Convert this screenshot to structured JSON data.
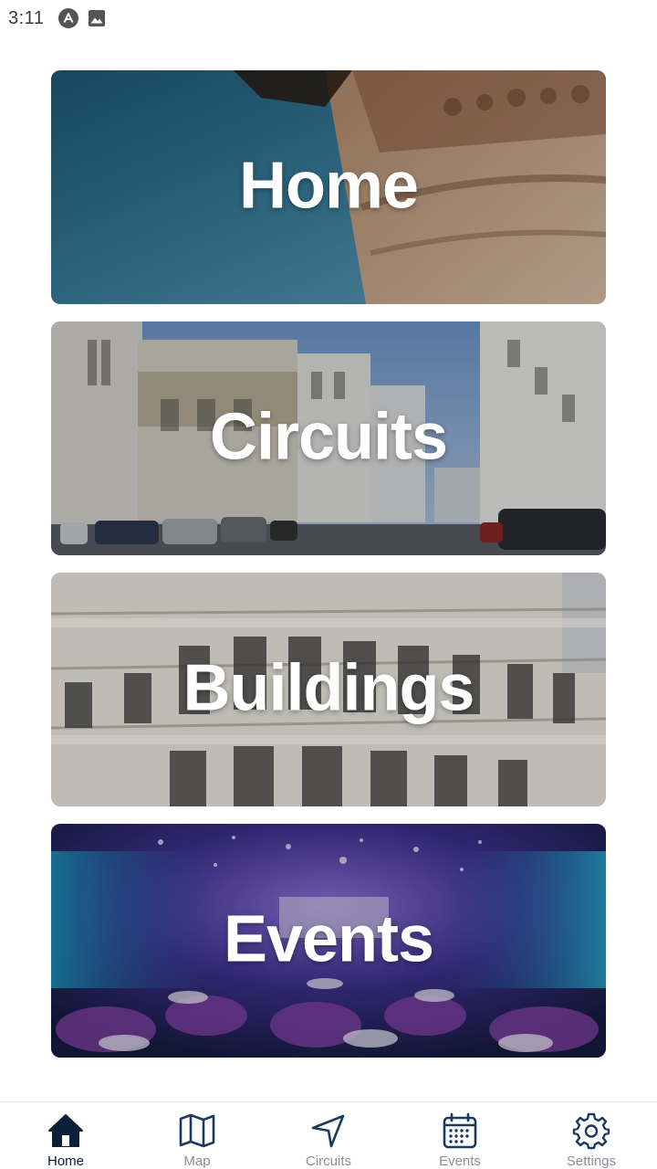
{
  "status_bar": {
    "time": "3:11",
    "icons": [
      "app-notification-icon",
      "image-notification-icon"
    ]
  },
  "cards": [
    {
      "title": "Home",
      "image": "carved-stone-architecture"
    },
    {
      "title": "Circuits",
      "image": "city-street"
    },
    {
      "title": "Buildings",
      "image": "building-facade"
    },
    {
      "title": "Events",
      "image": "conference-hall"
    }
  ],
  "bottom_nav": {
    "active": "Home",
    "items": [
      {
        "label": "Home",
        "icon": "home-icon"
      },
      {
        "label": "Map",
        "icon": "map-icon"
      },
      {
        "label": "Circuits",
        "icon": "navigation-arrow-icon"
      },
      {
        "label": "Events",
        "icon": "calendar-icon"
      },
      {
        "label": "Settings",
        "icon": "gear-icon"
      }
    ]
  },
  "colors": {
    "nav_active": "#0b1f3a",
    "nav_inactive_label": "#8a8f96",
    "nav_inactive_icon": "#1c3a60"
  }
}
